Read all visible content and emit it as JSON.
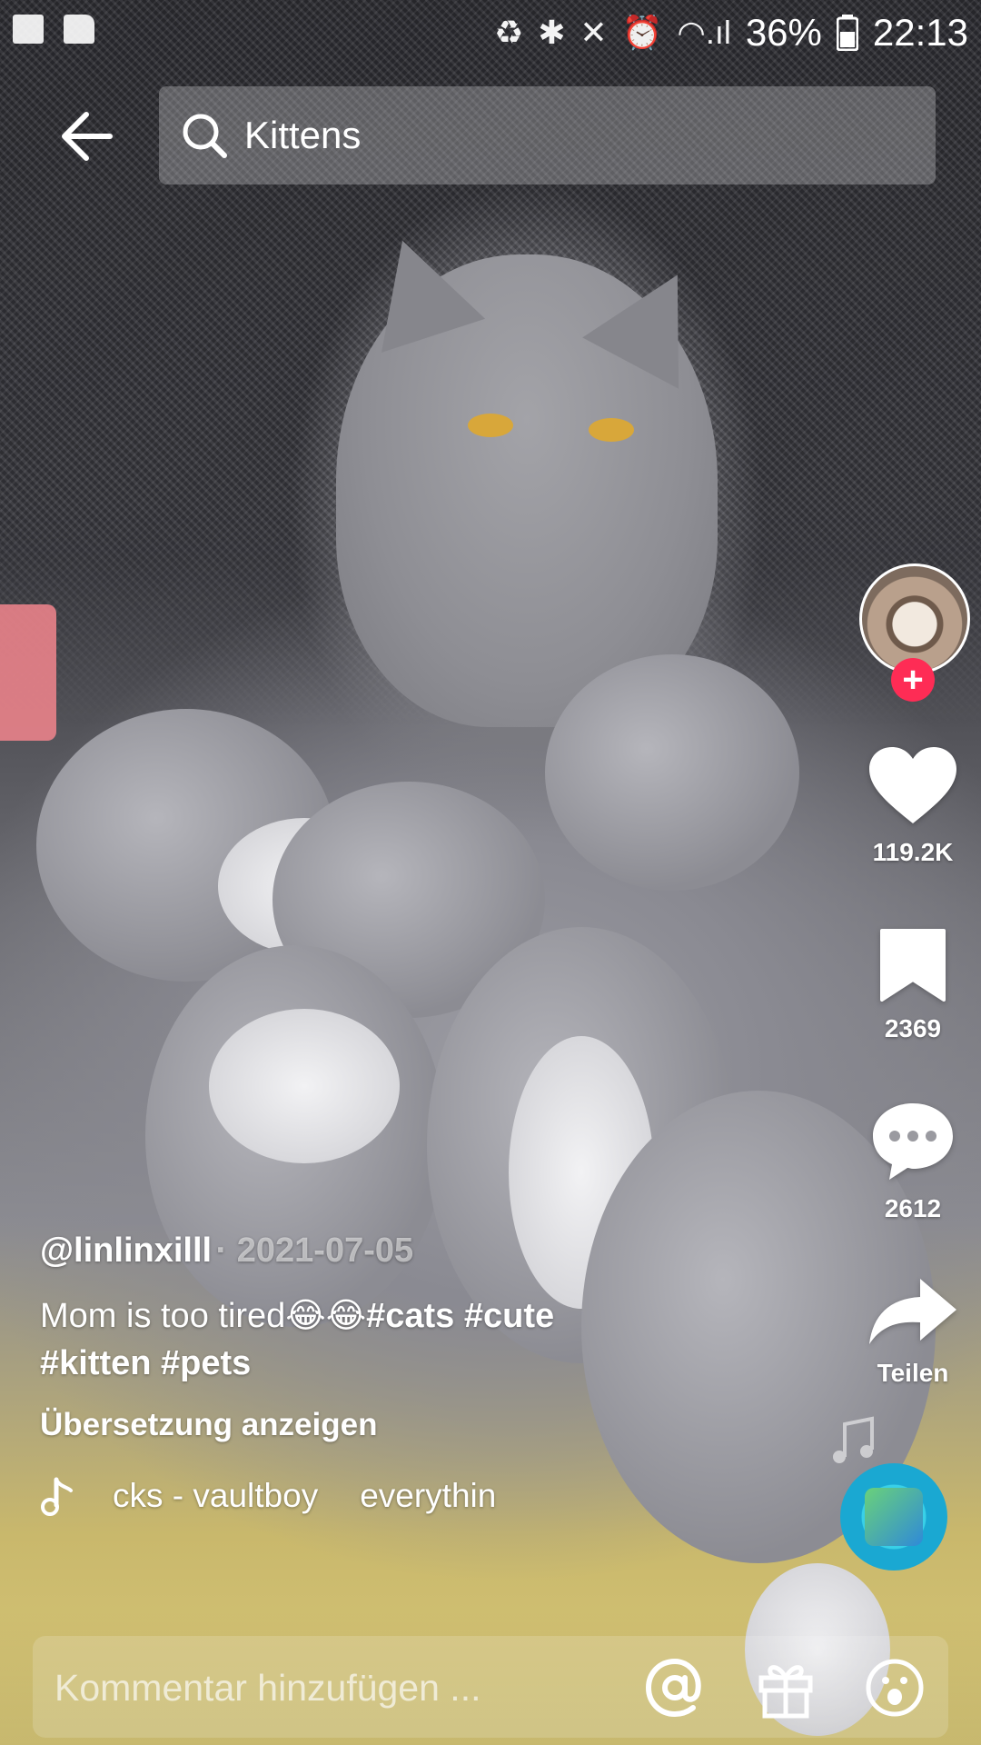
{
  "status": {
    "battery": "36%",
    "time": "22:13"
  },
  "search": {
    "query": "Kittens"
  },
  "actions": {
    "likes": "119.2K",
    "bookmarks": "2369",
    "comments": "2612",
    "share_label": "Teilen"
  },
  "post": {
    "handle": "@linlinxilll",
    "date": "2021-07-05",
    "desc_text": "Mom is too tired😂😂",
    "hashtags_line1": "#cats #cute",
    "hashtags_line2": "#kitten #pets",
    "translate": "Übersetzung anzeigen",
    "sound_part1": "cks - vaultboy",
    "sound_part2": "everythin"
  },
  "comment": {
    "placeholder": "Kommentar hinzufügen ..."
  },
  "icons": {
    "back": "arrow-left-icon",
    "search": "search-icon",
    "like": "heart-icon",
    "bookmark": "bookmark-icon",
    "comment": "comment-bubble-icon",
    "share": "share-arrow-icon",
    "mention": "at-icon",
    "gift": "gift-icon",
    "emoji": "emoji-icon"
  }
}
